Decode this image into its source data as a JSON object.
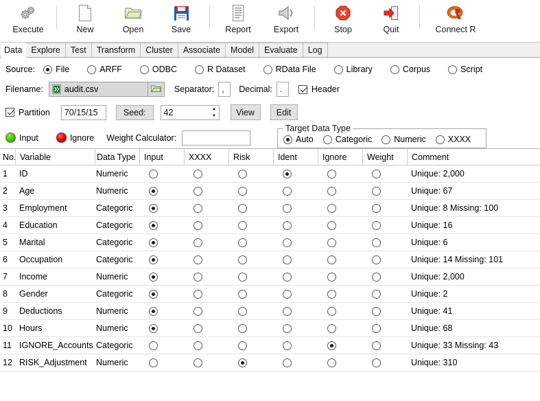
{
  "toolbar": {
    "items": [
      {
        "label": "Execute",
        "icon": "gears-icon"
      },
      {
        "label": "New",
        "icon": "new-document-icon"
      },
      {
        "label": "Open",
        "icon": "open-folder-icon"
      },
      {
        "label": "Save",
        "icon": "floppy-save-icon"
      },
      {
        "label": "Report",
        "icon": "report-document-icon"
      },
      {
        "label": "Export",
        "icon": "export-megaphone-icon"
      },
      {
        "label": "Stop",
        "icon": "stop-sign-icon"
      },
      {
        "label": "Quit",
        "icon": "quit-door-icon"
      },
      {
        "label": "Connect R",
        "icon": "r-logo-icon"
      }
    ]
  },
  "tabs": [
    {
      "label": "Data",
      "active": true
    },
    {
      "label": "Explore",
      "active": false
    },
    {
      "label": "Test",
      "active": false
    },
    {
      "label": "Transform",
      "active": false
    },
    {
      "label": "Cluster",
      "active": false
    },
    {
      "label": "Associate",
      "active": false
    },
    {
      "label": "Model",
      "active": false
    },
    {
      "label": "Evaluate",
      "active": false
    },
    {
      "label": "Log",
      "active": false
    }
  ],
  "source": {
    "label": "Source:",
    "options": [
      {
        "label": "File",
        "selected": true
      },
      {
        "label": "ARFF",
        "selected": false
      },
      {
        "label": "ODBC",
        "selected": false
      },
      {
        "label": "R Dataset",
        "selected": false
      },
      {
        "label": "RData File",
        "selected": false
      },
      {
        "label": "Library",
        "selected": false
      },
      {
        "label": "Corpus",
        "selected": false
      },
      {
        "label": "Script",
        "selected": false
      }
    ]
  },
  "file": {
    "filename_label": "Filename:",
    "filename_value": "audit.csv",
    "open_icon": "folder-icon",
    "file_icon": "csv-file-icon",
    "separator_label": "Separator:",
    "separator_value": ",",
    "decimal_label": "Decimal:",
    "decimal_value": ".",
    "header_label": "Header",
    "header_checked": true
  },
  "partition": {
    "label": "Partition",
    "checked": true,
    "ratio_value": "70/15/15",
    "seed_label": "Seed:",
    "seed_value": "42",
    "view_label": "View",
    "edit_label": "Edit"
  },
  "roles": {
    "input_label": "Input",
    "input_color": "#4fc510",
    "ignore_label": "Ignore",
    "ignore_color": "#e00f0f",
    "weight_label": "Weight Calculator:",
    "weight_value": ""
  },
  "target_data_type": {
    "legend": "Target Data Type",
    "options": [
      {
        "label": "Auto",
        "selected": true
      },
      {
        "label": "Categoric",
        "selected": false
      },
      {
        "label": "Numeric",
        "selected": false
      },
      {
        "label": "XXXX",
        "selected": false
      }
    ]
  },
  "table": {
    "columns": [
      "No.",
      "Variable",
      "Data Type",
      "Input",
      "XXXX",
      "Risk",
      "Ident",
      "Ignore",
      "Weight",
      "Comment"
    ],
    "rows": [
      {
        "no": "1",
        "variable": "ID",
        "type": "Numeric",
        "role": "Ident",
        "comment": "Unique: 2,000"
      },
      {
        "no": "2",
        "variable": "Age",
        "type": "Numeric",
        "role": "Input",
        "comment": "Unique: 67"
      },
      {
        "no": "3",
        "variable": "Employment",
        "type": "Categoric",
        "role": "Input",
        "comment": "Unique: 8 Missing: 100"
      },
      {
        "no": "4",
        "variable": "Education",
        "type": "Categoric",
        "role": "Input",
        "comment": "Unique: 16"
      },
      {
        "no": "5",
        "variable": "Marital",
        "type": "Categoric",
        "role": "Input",
        "comment": "Unique: 6"
      },
      {
        "no": "6",
        "variable": "Occupation",
        "type": "Categoric",
        "role": "Input",
        "comment": "Unique: 14 Missing: 101"
      },
      {
        "no": "7",
        "variable": "Income",
        "type": "Numeric",
        "role": "Input",
        "comment": "Unique: 2,000"
      },
      {
        "no": "8",
        "variable": "Gender",
        "type": "Categoric",
        "role": "Input",
        "comment": "Unique: 2"
      },
      {
        "no": "9",
        "variable": "Deductions",
        "type": "Numeric",
        "role": "Input",
        "comment": "Unique: 41"
      },
      {
        "no": "10",
        "variable": "Hours",
        "type": "Numeric",
        "role": "Input",
        "comment": "Unique: 68"
      },
      {
        "no": "11",
        "variable": "IGNORE_Accounts",
        "type": "Categoric",
        "role": "Ignore",
        "comment": "Unique: 33 Missing: 43"
      },
      {
        "no": "12",
        "variable": "RISK_Adjustment",
        "type": "Numeric",
        "role": "Risk",
        "comment": "Unique: 310"
      }
    ],
    "role_columns": [
      "Input",
      "XXXX",
      "Risk",
      "Ident",
      "Ignore",
      "Weight"
    ]
  }
}
